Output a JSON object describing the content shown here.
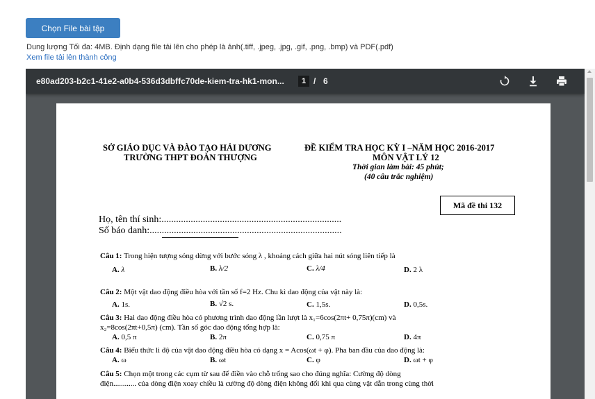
{
  "upload": {
    "button_label": "Chọn File bài tập",
    "hint": "Dung lượng Tối đa: 4MB. Định dạng file tải lên cho phép là ảnh(.tiff, .jpeg, .jpg, .gif, .png, .bmp) và PDF(.pdf)",
    "view_link": "Xem file tải lên thành công"
  },
  "viewer": {
    "doc_title": "e80ad203-b2c1-41e2-a0b4-536d3dbffc70de-kiem-tra-hk1-mon...",
    "current_page": "1",
    "page_separator": "/",
    "total_pages": "6",
    "icons": [
      "rotate-icon",
      "download-icon",
      "print-icon"
    ]
  },
  "document": {
    "left_header": [
      "SỞ GIÁO DỤC VÀ ĐÀO TẠO HẢI DƯƠNG",
      "TRƯỜNG THPT ĐOÀN THƯỢNG"
    ],
    "right_header": [
      "ĐỀ KIỂM TRA HỌC KỲ I –NĂM HỌC 2016-2017",
      "MÔN VẬT LÝ 12"
    ],
    "time": "Thời gian làm bài: 45 phút;",
    "count": "(40 câu trắc nghiệm)",
    "exam_code": "Mã đề thi 132",
    "name_line": "Họ, tên thí sinh:..........................................................................",
    "id_line": "Số báo danh:...............................................................................",
    "questions": [
      {
        "num": "Câu 1:",
        "text": " Trong hiện tượng sóng dừng với bước sóng  λ , khoảng cách giữa hai nút sóng liên tiếp là",
        "answers": [
          {
            "k": "A.",
            "v": " λ"
          },
          {
            "k": "B.",
            "v": " λ/2"
          },
          {
            "k": "C.",
            "v": " λ/4"
          },
          {
            "k": "D.",
            "v": " 2 λ"
          }
        ]
      },
      {
        "num": "Câu 2:",
        "text": " Một vật dao động điều hòa với tần số f=2 Hz. Chu kì dao động của vật này là:",
        "answers": [
          {
            "k": "A.",
            "v": " 1s."
          },
          {
            "k": "B.",
            "v": " √2 s."
          },
          {
            "k": "C.",
            "v": " 1,5s."
          },
          {
            "k": "D.",
            "v": " 0,5s."
          }
        ]
      },
      {
        "num": "Câu 3:",
        "text": "  Hai  dao  động  điều  hòa  có  phương  trình  dao  động  lần  lượt  là   x₁=6cos(2πt+  0,75π)(cm)  và",
        "text2": "x₂=8cos(2πt+0,5π) (cm). Tần số góc dao động tổng hợp là:",
        "answers": [
          {
            "k": "A.",
            "v": " 0,5 π"
          },
          {
            "k": "B.",
            "v": " 2π"
          },
          {
            "k": "C.",
            "v": " 0,75 π"
          },
          {
            "k": "D.",
            "v": " 4π"
          }
        ]
      },
      {
        "num": "Câu 4:",
        "text": " Biểu thức li độ của vật dao động điều hòa có dạng   x = Acos(ωt + φ). Pha ban đầu của dao động là:",
        "answers": [
          {
            "k": "A.",
            "v": " ω"
          },
          {
            "k": "B.",
            "v": " ωt"
          },
          {
            "k": "C.",
            "v": " φ"
          },
          {
            "k": "D.",
            "v": " ωt + φ"
          }
        ]
      },
      {
        "num": "Câu 5:",
        "text": "  Chọn  một  trong  các  cụm  từ  sau  để  điền  vào  chỗ  trống  sao  cho  đúng  nghĩa:  Cường  độ  dòng",
        "text2": "điện............ của dòng điện xoay chiều là cường độ dòng điện không đổi khi qua cùng vật dẫn trong cùng thời"
      }
    ]
  }
}
